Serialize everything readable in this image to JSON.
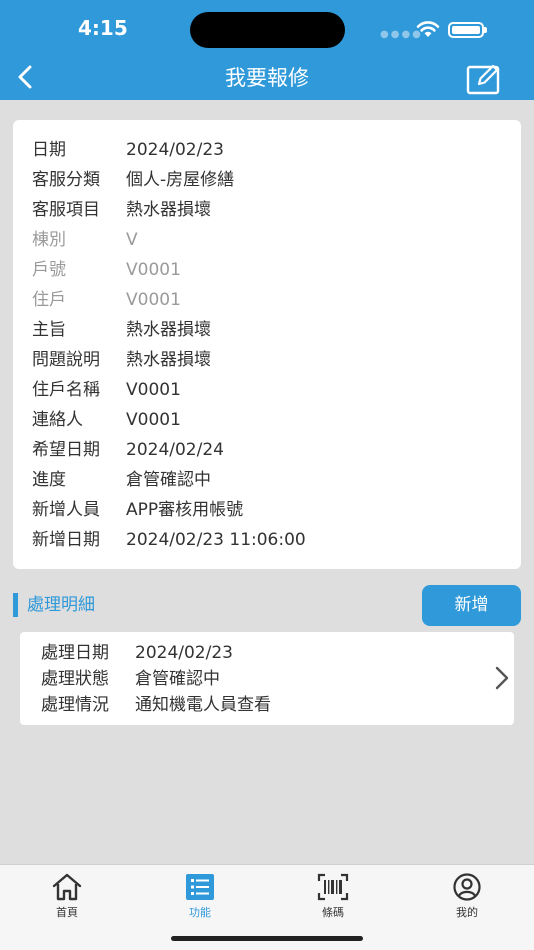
{
  "status_bar": {
    "time": "4:15"
  },
  "header": {
    "title": "我要報修"
  },
  "info": [
    {
      "label": "日期",
      "value": "2024/02/23",
      "dim": false
    },
    {
      "label": "客服分類",
      "value": "個人-房屋修繕",
      "dim": false
    },
    {
      "label": "客服項目",
      "value": "熱水器損壞",
      "dim": false
    },
    {
      "label": "棟別",
      "value": "V",
      "dim": true
    },
    {
      "label": "戶號",
      "value": "V0001",
      "dim": true
    },
    {
      "label": "住戶",
      "value": "V0001",
      "dim": true
    },
    {
      "label": "主旨",
      "value": "熱水器損壞",
      "dim": false
    },
    {
      "label": "問題說明",
      "value": "熱水器損壞",
      "dim": false
    },
    {
      "label": "住戶名稱",
      "value": "V0001",
      "dim": false
    },
    {
      "label": "連絡人",
      "value": "V0001",
      "dim": false
    },
    {
      "label": "希望日期",
      "value": "2024/02/24",
      "dim": false
    },
    {
      "label": "進度",
      "value": "倉管確認中",
      "dim": false
    },
    {
      "label": "新增人員",
      "value": "APP審核用帳號",
      "dim": false
    },
    {
      "label": "新增日期",
      "value": "2024/02/23 11:06:00",
      "dim": false
    }
  ],
  "section": {
    "title": "處理明細",
    "add_label": "新增"
  },
  "detail": [
    {
      "label": "處理日期",
      "value": "2024/02/23"
    },
    {
      "label": "處理狀態",
      "value": "倉管確認中"
    },
    {
      "label": "處理情況",
      "value": "通知機電人員查看"
    }
  ],
  "tabs": [
    {
      "label": "首頁",
      "icon": "home-icon",
      "active": false
    },
    {
      "label": "功能",
      "icon": "list-icon",
      "active": true
    },
    {
      "label": "條碼",
      "icon": "barcode-icon",
      "active": false
    },
    {
      "label": "我的",
      "icon": "user-icon",
      "active": false
    }
  ],
  "colors": {
    "primary": "#2f99d9",
    "background": "#dedede",
    "card": "#ffffff"
  }
}
